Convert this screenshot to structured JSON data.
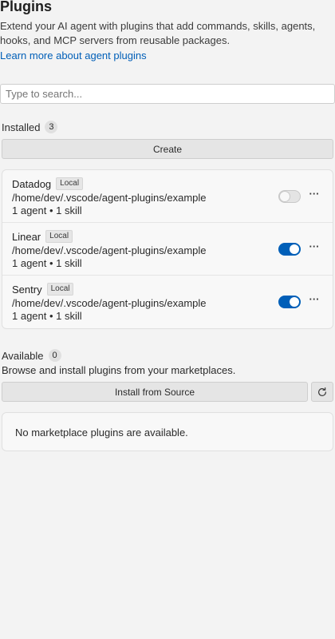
{
  "header": {
    "title": "Plugins",
    "description": "Extend your AI agent with plugins that add commands, skills, agents, hooks, and MCP servers from reusable packages.",
    "learn_more_link": "Learn more about agent plugins"
  },
  "search": {
    "placeholder": "Type to search..."
  },
  "installed": {
    "label": "Installed",
    "count": "3",
    "create_label": "Create",
    "plugins": [
      {
        "name": "Datadog",
        "badge": "Local",
        "path": "/home/dev/.vscode/agent-plugins/example",
        "meta": "1 agent • 1 skill",
        "enabled": false
      },
      {
        "name": "Linear",
        "badge": "Local",
        "path": "/home/dev/.vscode/agent-plugins/example",
        "meta": "1 agent • 1 skill",
        "enabled": true
      },
      {
        "name": "Sentry",
        "badge": "Local",
        "path": "/home/dev/.vscode/agent-plugins/example",
        "meta": "1 agent • 1 skill",
        "enabled": true
      }
    ],
    "more_icon": "···"
  },
  "available": {
    "label": "Available",
    "count": "0",
    "browse_text": "Browse and install plugins from your marketplaces.",
    "install_label": "Install from Source",
    "empty_text": "No marketplace plugins are available."
  },
  "colors": {
    "accent": "#005fb8",
    "link": "#005fb8",
    "background": "#f3f3f3"
  },
  "icons": {
    "refresh": "refresh-icon",
    "more": "more-actions-icon"
  }
}
